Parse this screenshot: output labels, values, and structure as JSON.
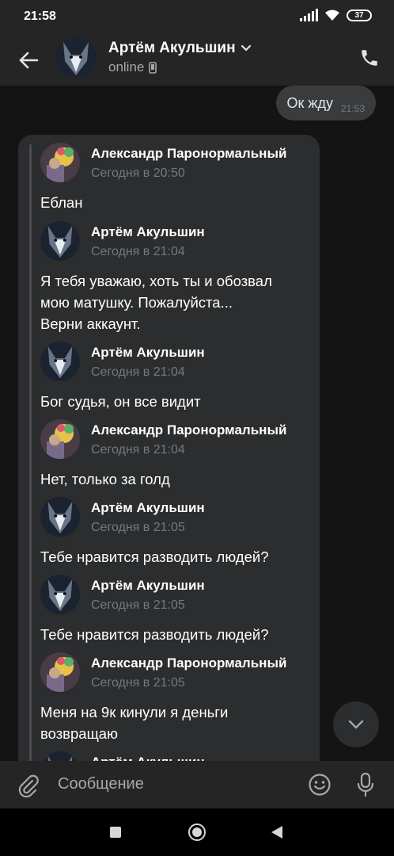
{
  "status_bar": {
    "time": "21:58",
    "battery": "37"
  },
  "header": {
    "contact_name": "Артём Акульшин",
    "status": "online"
  },
  "chat": {
    "outgoing": {
      "text": "Ок жду",
      "time": "21:53"
    },
    "forwarded": [
      {
        "author": "Александр Паронормальный",
        "time": "Сегодня в 20:50",
        "text": "Еблан",
        "avatar": "alexander"
      },
      {
        "author": "Артём Акульшин",
        "time": "Сегодня в 21:04",
        "text": "Я тебя уважаю,  хоть ты и обозвал\nмою матушку.  Пожалуйста...\nВерни аккаунт.",
        "avatar": "artem"
      },
      {
        "author": "Артём Акульшин",
        "time": "Сегодня в 21:04",
        "text": "Бог судья,  он все видит",
        "avatar": "artem"
      },
      {
        "author": "Александр Паронормальный",
        "time": "Сегодня в 21:04",
        "text": "Нет, только за голд",
        "avatar": "alexander"
      },
      {
        "author": "Артём Акульшин",
        "time": "Сегодня в 21:05",
        "text": "Тебе нравится разводить людей?",
        "avatar": "artem"
      },
      {
        "author": "Артём Акульшин",
        "time": "Сегодня в 21:05",
        "text": "Тебе нравится разводить людей?",
        "avatar": "artem"
      },
      {
        "author": "Александр Паронормальный",
        "time": "Сегодня в 21:05",
        "text": "Меня на 9к кинули я деньги\nвозвращаю",
        "avatar": "alexander"
      },
      {
        "author": "Артём Акульшин",
        "time": "",
        "text": "",
        "avatar": "artem"
      }
    ]
  },
  "composer": {
    "placeholder": "Сообщение"
  },
  "colors": {
    "background": "#141414",
    "bar": "#252525",
    "bubble": "#2c2d2e",
    "outgoing": "#3a3b3d",
    "muted": "#76787a"
  },
  "icons": [
    "back-arrow-icon",
    "phone-icon",
    "chevron-down-icon",
    "mobile-icon",
    "attach-icon",
    "smile-icon",
    "mic-icon"
  ]
}
